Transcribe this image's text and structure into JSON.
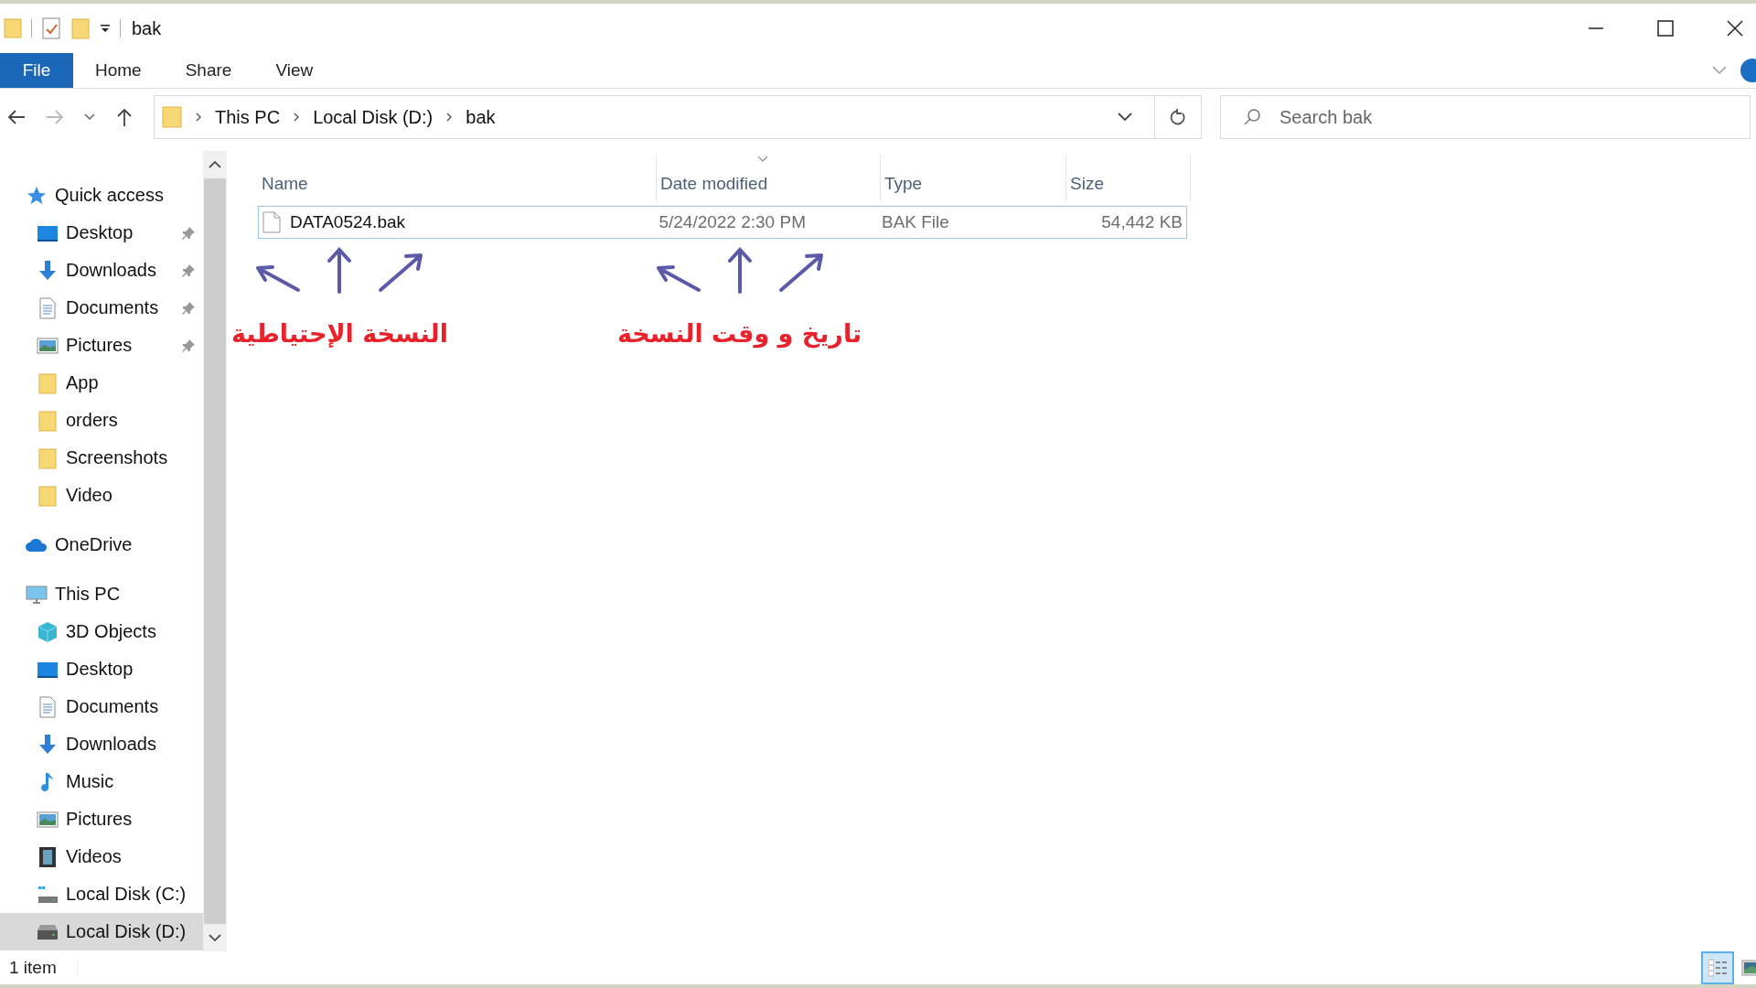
{
  "window": {
    "title": "bak"
  },
  "ribbon_tabs": [
    {
      "label": "File",
      "selected": true
    },
    {
      "label": "Home",
      "selected": false
    },
    {
      "label": "Share",
      "selected": false
    },
    {
      "label": "View",
      "selected": false
    }
  ],
  "breadcrumb": [
    "This PC",
    "Local Disk (D:)",
    "bak"
  ],
  "search": {
    "placeholder": "Search bak"
  },
  "sidebar": [
    {
      "label": "Quick access",
      "kind": "star",
      "selected": false,
      "children": [
        {
          "label": "Desktop",
          "kind": "desktop",
          "pinned": true,
          "selected": false
        },
        {
          "label": "Downloads",
          "kind": "download",
          "pinned": true,
          "selected": false
        },
        {
          "label": "Documents",
          "kind": "documents",
          "pinned": true,
          "selected": false
        },
        {
          "label": "Pictures",
          "kind": "pictures",
          "pinned": true,
          "selected": false
        },
        {
          "label": "App",
          "kind": "folder",
          "pinned": false,
          "selected": false
        },
        {
          "label": "orders",
          "kind": "folder",
          "pinned": false,
          "selected": false
        },
        {
          "label": "Screenshots",
          "kind": "folder",
          "pinned": false,
          "selected": false
        },
        {
          "label": "Video",
          "kind": "folder",
          "pinned": false,
          "selected": false
        }
      ]
    },
    {
      "label": "OneDrive",
      "kind": "cloud",
      "selected": false
    },
    {
      "label": "This PC",
      "kind": "pc",
      "selected": false,
      "children": [
        {
          "label": "3D Objects",
          "kind": "cube",
          "pinned": false,
          "selected": false
        },
        {
          "label": "Desktop",
          "kind": "desktop",
          "pinned": false,
          "selected": false
        },
        {
          "label": "Documents",
          "kind": "documents",
          "pinned": false,
          "selected": false
        },
        {
          "label": "Downloads",
          "kind": "download",
          "pinned": false,
          "selected": false
        },
        {
          "label": "Music",
          "kind": "music",
          "pinned": false,
          "selected": false
        },
        {
          "label": "Pictures",
          "kind": "pictures",
          "pinned": false,
          "selected": false
        },
        {
          "label": "Videos",
          "kind": "videos",
          "pinned": false,
          "selected": false
        },
        {
          "label": "Local Disk (C:)",
          "kind": "system-drive",
          "pinned": false,
          "selected": false
        },
        {
          "label": "Local Disk (D:)",
          "kind": "drive",
          "pinned": false,
          "selected": true
        }
      ]
    }
  ],
  "columns": [
    {
      "label": "Name",
      "sorted": false
    },
    {
      "label": "Date modified",
      "sorted": true
    },
    {
      "label": "Type",
      "sorted": false
    },
    {
      "label": "Size",
      "sorted": false
    }
  ],
  "files": [
    {
      "name": "DATA0524.bak",
      "date_modified": "5/24/2022 2:30 PM",
      "type": "BAK File",
      "size": "54,442 KB",
      "selected": true
    }
  ],
  "annotations": [
    "تاريخ و وقت النسخة",
    "النسخة الإحتياطية"
  ],
  "status_bar": {
    "count": "1 item"
  },
  "view_buttons": [
    {
      "kind": "details",
      "selected": true
    },
    {
      "kind": "large-icons",
      "selected": false
    }
  ]
}
